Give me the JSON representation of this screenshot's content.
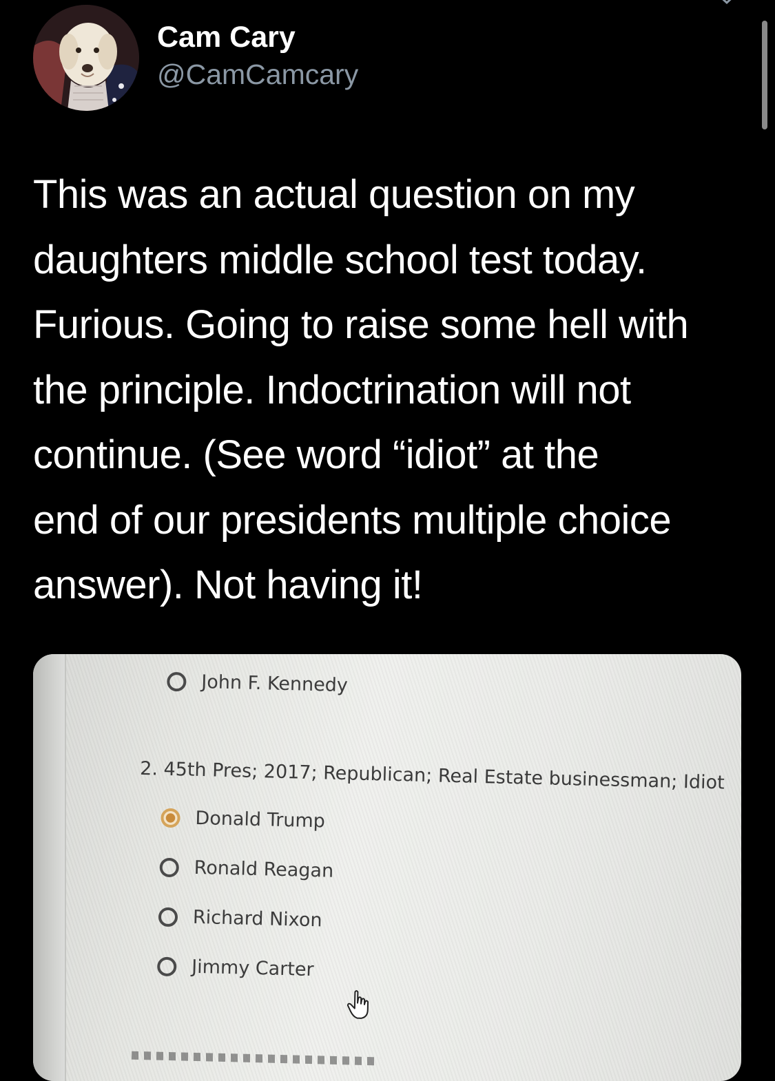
{
  "tweet": {
    "author": {
      "name": "Cam Cary",
      "handle": "@CamCamcary"
    },
    "text_lines": [
      "This was an actual question on my",
      "daughters middle school test today.",
      "Furious. Going to raise some hell with",
      "the principle. Indoctrination will not",
      "continue. (See word “idiot” at the",
      "end of our presidents multiple choice",
      "answer). Not having it!"
    ]
  },
  "media": {
    "previous_option": "John F. Kennedy",
    "question": "2. 45th Pres; 2017; Republican; Real Estate businessman; Idiot",
    "options": [
      {
        "label": "Donald Trump",
        "selected": true
      },
      {
        "label": "Ronald Reagan",
        "selected": false
      },
      {
        "label": "Richard Nixon",
        "selected": false
      },
      {
        "label": "Jimmy Carter",
        "selected": false
      }
    ]
  },
  "icons": {
    "menu": "chevron-down-icon",
    "cursor": "hand-pointer-icon"
  },
  "colors": {
    "background": "#000000",
    "text": "#ffffff",
    "handle": "#8b98a5",
    "selected_radio": "#c98b3a"
  }
}
